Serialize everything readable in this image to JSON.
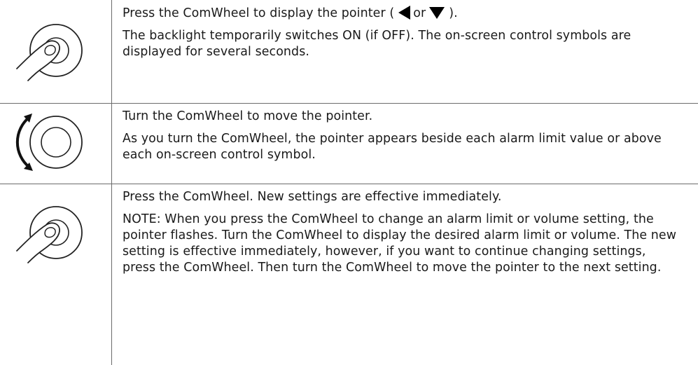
{
  "rows": [
    {
      "icon": "press-comwheel-icon",
      "line1_before": "Press the ComWheel to display the pointer (",
      "line1_or": "or",
      "line1_after": ").",
      "pointer_symbols": [
        "left-triangle-icon",
        "down-triangle-icon"
      ],
      "paragraph2": "The backlight temporarily switches ON (if OFF). The on-screen control symbols are displayed for several seconds."
    },
    {
      "icon": "turn-comwheel-icon",
      "paragraph1": "Turn the ComWheel to move the pointer.",
      "paragraph2": "As you turn the ComWheel, the pointer appears beside each alarm limit value or above each on-screen control symbol."
    },
    {
      "icon": "press-comwheel-icon",
      "paragraph1": "Press the ComWheel. New settings are effective immediately.",
      "paragraph2": "NOTE:  When you press the ComWheel to change an alarm limit or volume setting, the pointer flashes. Turn the ComWheel to display the desired alarm limit or volume. The new setting is effective immediately, however, if you want to continue changing settings, press the ComWheel. Then turn the ComWheel to move the pointer to the next setting."
    }
  ]
}
